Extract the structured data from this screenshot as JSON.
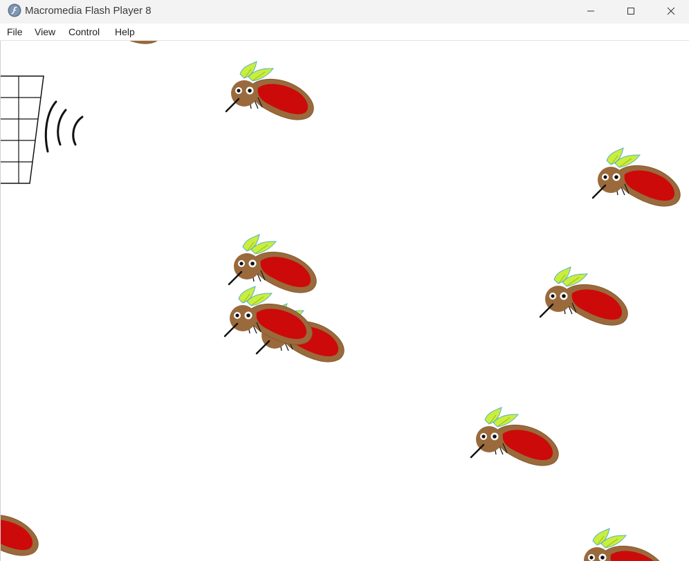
{
  "window": {
    "title": "Macromedia Flash Player 8",
    "app_icon": "flash-player-icon",
    "controls": [
      "minimize-icon",
      "maximize-icon",
      "close-icon"
    ]
  },
  "menu": {
    "items": [
      {
        "label": "File"
      },
      {
        "label": "View"
      },
      {
        "label": "Control"
      },
      {
        "label": "Help"
      }
    ]
  },
  "game": {
    "background": "#ffffff",
    "sprites": {
      "mosquito": {
        "body_color": "#9a6a3c",
        "belly_color": "#cc0a0a",
        "wing_color": "#c9ee3c",
        "count_visible": 11
      },
      "swatter": {
        "icon": "fly-swatter-icon"
      }
    }
  }
}
